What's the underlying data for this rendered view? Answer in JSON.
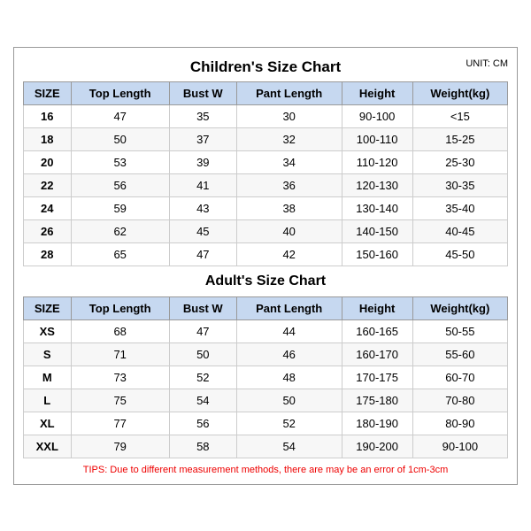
{
  "mainTitle": "Children's Size Chart",
  "unitLabel": "UNIT: CM",
  "children": {
    "headers": [
      "SIZE",
      "Top Length",
      "Bust W",
      "Pant Length",
      "Height",
      "Weight(kg)"
    ],
    "rows": [
      [
        "16",
        "47",
        "35",
        "30",
        "90-100",
        "<15"
      ],
      [
        "18",
        "50",
        "37",
        "32",
        "100-110",
        "15-25"
      ],
      [
        "20",
        "53",
        "39",
        "34",
        "110-120",
        "25-30"
      ],
      [
        "22",
        "56",
        "41",
        "36",
        "120-130",
        "30-35"
      ],
      [
        "24",
        "59",
        "43",
        "38",
        "130-140",
        "35-40"
      ],
      [
        "26",
        "62",
        "45",
        "40",
        "140-150",
        "40-45"
      ],
      [
        "28",
        "65",
        "47",
        "42",
        "150-160",
        "45-50"
      ]
    ]
  },
  "adultsTitle": "Adult's Size Chart",
  "adults": {
    "headers": [
      "SIZE",
      "Top Length",
      "Bust W",
      "Pant Length",
      "Height",
      "Weight(kg)"
    ],
    "rows": [
      [
        "XS",
        "68",
        "47",
        "44",
        "160-165",
        "50-55"
      ],
      [
        "S",
        "71",
        "50",
        "46",
        "160-170",
        "55-60"
      ],
      [
        "M",
        "73",
        "52",
        "48",
        "170-175",
        "60-70"
      ],
      [
        "L",
        "75",
        "54",
        "50",
        "175-180",
        "70-80"
      ],
      [
        "XL",
        "77",
        "56",
        "52",
        "180-190",
        "80-90"
      ],
      [
        "XXL",
        "79",
        "58",
        "54",
        "190-200",
        "90-100"
      ]
    ]
  },
  "tips": "TIPS: Due to different measurement methods, there are may be an error of 1cm-3cm"
}
